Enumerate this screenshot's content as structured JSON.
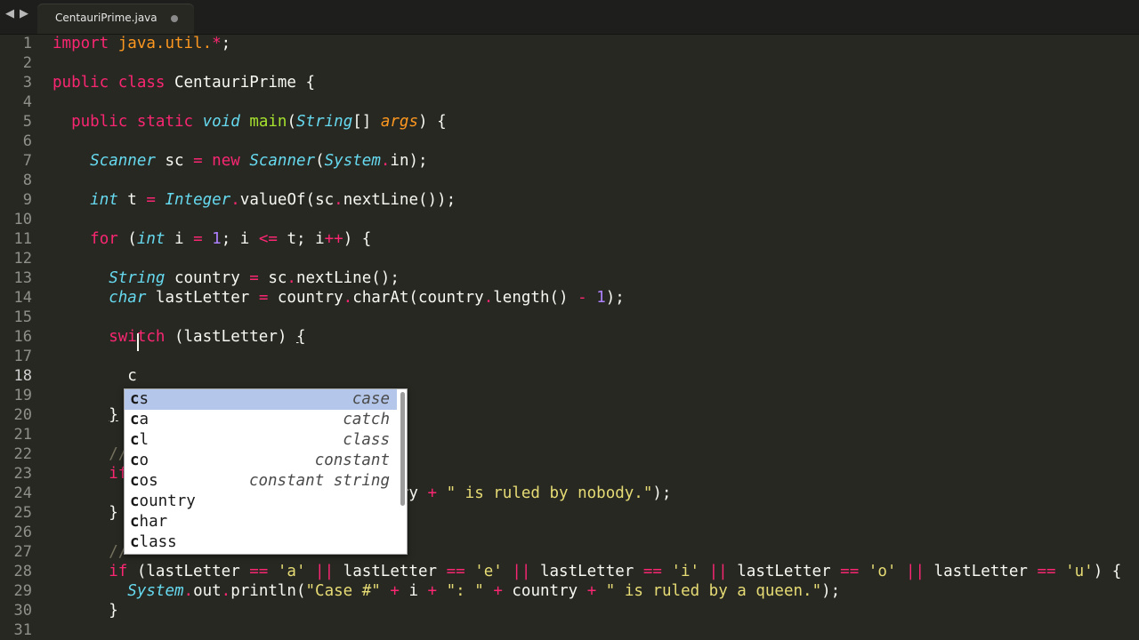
{
  "tabbar": {
    "back_icon": "◀",
    "forward_icon": "▶",
    "active_tab": "CentauriPrime.java",
    "dirty_indicator_color": "#8a8a8a"
  },
  "editor": {
    "theme": "Monokai",
    "current_line": 18,
    "lines": [
      {
        "n": "1",
        "html": "<span class=\"k\">import</span> <span class=\"p\" style=\"font-style:normal\">java.util.</span><span class=\"k\">*</span>;"
      },
      {
        "n": "2",
        "html": ""
      },
      {
        "n": "3",
        "html": "<span class=\"k\">public</span> <span class=\"k\">class</span> CentauriPrime {"
      },
      {
        "n": "4",
        "html": ""
      },
      {
        "n": "5",
        "html": "  <span class=\"k\">public</span> <span class=\"k\">static</span> <span class=\"t\">void</span> <span class=\"f\">main</span>(<span class=\"t\">String</span>[] <span class=\"p\">args</span>) {"
      },
      {
        "n": "6",
        "html": ""
      },
      {
        "n": "7",
        "html": "    <span class=\"t\">Scanner</span> sc <span class=\"k\">=</span> <span class=\"k\">new</span> <span class=\"t\">Scanner</span>(<span class=\"t\">System</span><span class=\"k\">.</span>in);"
      },
      {
        "n": "8",
        "html": ""
      },
      {
        "n": "9",
        "html": "    <span class=\"t\">int</span> t <span class=\"k\">=</span> <span class=\"t\">Integer</span><span class=\"k\">.</span>valueOf(sc<span class=\"k\">.</span>nextLine());"
      },
      {
        "n": "10",
        "html": ""
      },
      {
        "n": "11",
        "html": "    <span class=\"k\">for</span> (<span class=\"t\">int</span> i <span class=\"k\">=</span> <span class=\"n\">1</span>; i <span class=\"k\">&lt;=</span> t; i<span class=\"k\">++</span>) {"
      },
      {
        "n": "12",
        "html": ""
      },
      {
        "n": "13",
        "html": "      <span class=\"t\">String</span> country <span class=\"k\">=</span> sc<span class=\"k\">.</span>nextLine();"
      },
      {
        "n": "14",
        "html": "      <span class=\"t\">char</span> lastLetter <span class=\"k\">=</span> country<span class=\"k\">.</span>charAt(country<span class=\"k\">.</span>length() <span class=\"k\">-</span> <span class=\"n\">1</span>);"
      },
      {
        "n": "15",
        "html": ""
      },
      {
        "n": "16",
        "html": "      <span class=\"k\">switch</span> (lastLetter) <span class=\"u\">{</span>"
      },
      {
        "n": "17",
        "html": ""
      },
      {
        "n": "18",
        "html": "        c"
      },
      {
        "n": "19",
        "html": ""
      },
      {
        "n": "20",
        "html": "      <span class=\"u\">}</span>"
      },
      {
        "n": "21",
        "html": ""
      },
      {
        "n": "22",
        "html": "      <span class=\"c\">//</span>"
      },
      {
        "n": "23",
        "html": "      <span class=\"k\">if</span>"
      },
      {
        "n": "24",
        "html": "                     i <span class=\"k\">+</span> <span class=\"s\">\": \"</span> <span class=\"k\">+</span> country <span class=\"k\">+</span> <span class=\"s\">\" is ruled by nobody.\"</span>);"
      },
      {
        "n": "25",
        "html": "      }"
      },
      {
        "n": "26",
        "html": ""
      },
      {
        "n": "27",
        "html": "      <span class=\"c\">//</span>"
      },
      {
        "n": "28",
        "html": "      <span class=\"k\">if</span> (lastLetter <span class=\"k\">==</span> <span class=\"s\">'a'</span> <span class=\"k\">||</span> lastLetter <span class=\"k\">==</span> <span class=\"s\">'e'</span> <span class=\"k\">||</span> lastLetter <span class=\"k\">==</span> <span class=\"s\">'i'</span> <span class=\"k\">||</span> lastLetter <span class=\"k\">==</span> <span class=\"s\">'o'</span> <span class=\"k\">||</span> lastLetter <span class=\"k\">==</span> <span class=\"s\">'u'</span>) {"
      },
      {
        "n": "29",
        "html": "        <span class=\"t\">System</span><span class=\"k\">.</span>out<span class=\"k\">.</span>println(<span class=\"s\">\"Case #\"</span> <span class=\"k\">+</span> i <span class=\"k\">+</span> <span class=\"s\">\": \"</span> <span class=\"k\">+</span> country <span class=\"k\">+</span> <span class=\"s\">\" is ruled by a queen.\"</span>);"
      },
      {
        "n": "30",
        "html": "      }"
      },
      {
        "n": "31",
        "html": ""
      }
    ]
  },
  "autocomplete": {
    "selected_index": 0,
    "items": [
      {
        "typed": "c",
        "rest": "s",
        "hint": "case"
      },
      {
        "typed": "c",
        "rest": "a",
        "hint": "catch"
      },
      {
        "typed": "c",
        "rest": "l",
        "hint": "class"
      },
      {
        "typed": "c",
        "rest": "o",
        "hint": "constant"
      },
      {
        "typed": "c",
        "rest": "os",
        "hint": "constant string"
      },
      {
        "typed": "c",
        "rest": "ountry",
        "hint": ""
      },
      {
        "typed": "c",
        "rest": "har",
        "hint": ""
      },
      {
        "typed": "c",
        "rest": "lass",
        "hint": ""
      }
    ]
  }
}
